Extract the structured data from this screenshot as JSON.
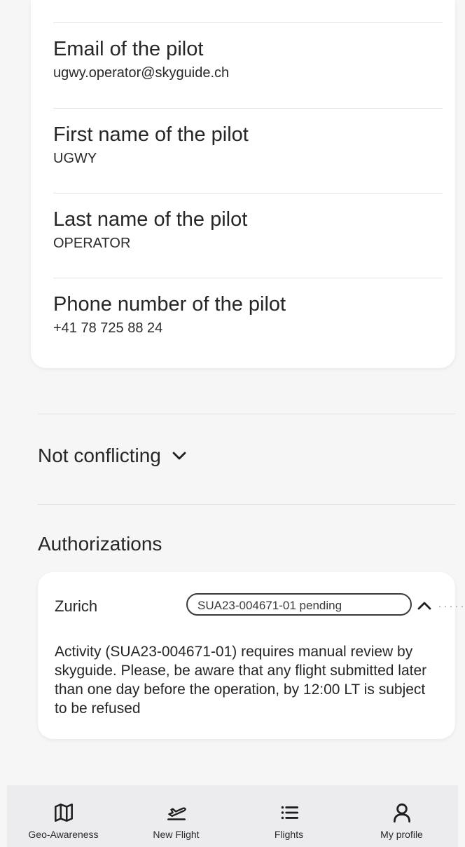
{
  "pilot": {
    "fields": [
      {
        "label": "Email of the pilot",
        "value": "ugwy.operator@skyguide.ch"
      },
      {
        "label": "First name of the pilot",
        "value": "UGWY"
      },
      {
        "label": "Last name of the pilot",
        "value": "OPERATOR"
      },
      {
        "label": "Phone number of the pilot",
        "value": "+41 78 725 88 24"
      }
    ]
  },
  "conflict": {
    "label": "Not conflicting",
    "icon": "chevron-down-icon"
  },
  "authorizations": {
    "title": "Authorizations",
    "items": [
      {
        "region": "Zurich",
        "badge": "SUA23-004671-01 pending",
        "message": "Activity (SUA23-004671-01) requires manual review by skyguide. Please, be aware that any flight submitted later than one day before the operation, by 12:00 LT is subject to be refused",
        "icon": "chevron-up-icon"
      }
    ]
  },
  "nav": {
    "items": [
      {
        "label": "Geo-Awareness",
        "icon": "map-icon"
      },
      {
        "label": "New Flight",
        "icon": "plane-takeoff-icon"
      },
      {
        "label": "Flights",
        "icon": "list-icon"
      },
      {
        "label": "My profile",
        "icon": "user-icon"
      }
    ]
  },
  "colors": {
    "background": "#f6f6f7",
    "card": "#ffffff",
    "text": "#262626",
    "divider": "#e3e3e3",
    "nav_background": "#ececee"
  }
}
